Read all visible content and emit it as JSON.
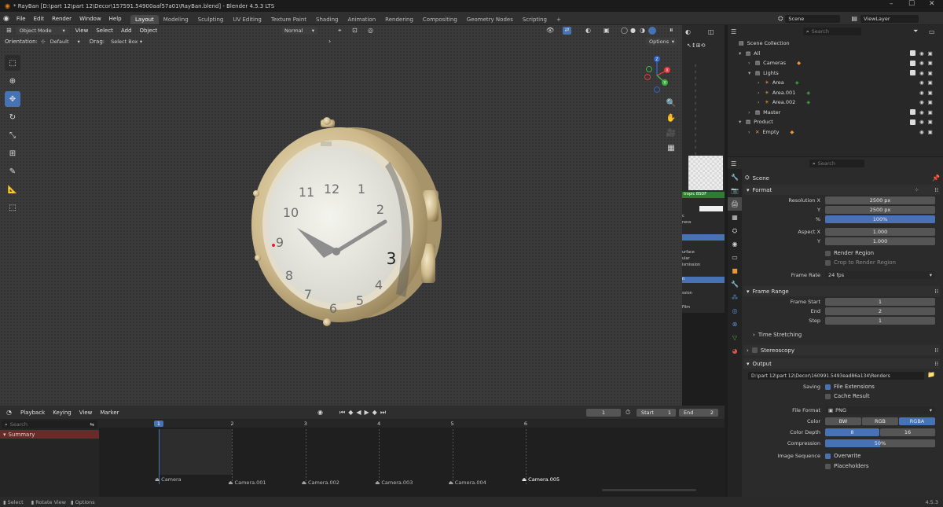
{
  "window": {
    "title": "* RayBan [D:\\part 12\\part 12\\Decor\\157591.54900aaf57a01\\RayBan.blend] - Blender 4.5.3 LTS"
  },
  "menu": [
    "File",
    "Edit",
    "Render",
    "Window",
    "Help"
  ],
  "workspaces": [
    {
      "label": "Layout",
      "active": true
    },
    {
      "label": "Modeling"
    },
    {
      "label": "Sculpting"
    },
    {
      "label": "UV Editing"
    },
    {
      "label": "Texture Paint"
    },
    {
      "label": "Shading"
    },
    {
      "label": "Animation"
    },
    {
      "label": "Rendering"
    },
    {
      "label": "Compositing"
    },
    {
      "label": "Geometry Nodes"
    },
    {
      "label": "Scripting"
    }
  ],
  "scene_name": "Scene",
  "view_layer": "ViewLayer",
  "viewport": {
    "mode": "Object Mode",
    "menus": [
      "View",
      "Select",
      "Add",
      "Object"
    ],
    "transform_orientation": "Normal",
    "orientation_label": "Orientation:",
    "orientation_value": "Default",
    "drag_label": "Drag:",
    "drag_value": "Select Box",
    "options_label": "Options",
    "gizmo_labels": {
      "z": "Z",
      "y": "Y",
      "x": "X"
    }
  },
  "midpanel_items": [
    "tropic BSDF",
    "c",
    "ness",
    "urface",
    "ular",
    "ismission",
    "n",
    "ssion",
    "Film"
  ],
  "outliner": {
    "search_placeholder": "Search",
    "root": "Scene Collection",
    "rows": [
      {
        "label": "All",
        "indent": 0,
        "expander": "▾",
        "kind": "collection",
        "checkbox": true,
        "eye": true,
        "camera": true
      },
      {
        "label": "Cameras",
        "indent": 1,
        "expander": "›",
        "kind": "collection",
        "checkbox": true,
        "eye": true,
        "camera": true
      },
      {
        "label": "Lights",
        "indent": 1,
        "expander": "▾",
        "kind": "collection",
        "checkbox": true,
        "eye": true,
        "camera": true
      },
      {
        "label": "Area",
        "indent": 2,
        "expander": "›",
        "kind": "light",
        "eye": true,
        "camera": true
      },
      {
        "label": "Area.001",
        "indent": 2,
        "expander": "›",
        "kind": "light",
        "eye": true,
        "camera": true
      },
      {
        "label": "Area.002",
        "indent": 2,
        "expander": "›",
        "kind": "light",
        "eye": true,
        "camera": true
      },
      {
        "label": "Master",
        "indent": 1,
        "expander": "›",
        "kind": "collection",
        "checkbox": true,
        "eye": true,
        "camera": true
      },
      {
        "label": "Product",
        "indent": 0,
        "expander": "▾",
        "kind": "collection",
        "checkbox": true,
        "eye": true,
        "camera": true
      },
      {
        "label": "Empty",
        "indent": 1,
        "expander": "›",
        "kind": "empty",
        "eye": true,
        "camera": true
      }
    ]
  },
  "properties": {
    "search_placeholder": "Search",
    "context": "Scene",
    "format": {
      "header": "Format",
      "resolution_x_label": "Resolution X",
      "resolution_x": "2500 px",
      "y_label": "Y",
      "resolution_y": "2500 px",
      "percent_label": "%",
      "percent": "100%",
      "aspect_x_label": "Aspect X",
      "aspect_x": "1.000",
      "aspect_y_label": "Y",
      "aspect_y": "1.000",
      "render_region": "Render Region",
      "crop_region": "Crop to Render Region",
      "frame_rate_label": "Frame Rate",
      "frame_rate": "24 fps"
    },
    "frame_range": {
      "header": "Frame Range",
      "start_label": "Frame Start",
      "start": "1",
      "end_label": "End",
      "end": "2",
      "step_label": "Step",
      "step": "1",
      "time_stretching": "Time Stretching"
    },
    "stereoscopy": "Stereoscopy",
    "output": {
      "header": "Output",
      "path": "D:\\part 12\\part 12\\Decor\\160991.5493ead86a134\\Renders",
      "saving_label": "Saving",
      "file_extensions": "File Extensions",
      "cache_result": "Cache Result",
      "file_format_label": "File Format",
      "file_format": "PNG",
      "color_label": "Color",
      "color_options": [
        "BW",
        "RGB",
        "RGBA"
      ],
      "color_selected": "RGBA",
      "color_depth_label": "Color Depth",
      "color_depth_options": [
        "8",
        "16"
      ],
      "color_depth_selected": "8",
      "compression_label": "Compression",
      "compression": "50%",
      "compression_value": 50,
      "image_sequence_label": "Image Sequence",
      "overwrite": "Overwrite",
      "placeholders": "Placeholders"
    }
  },
  "timeline": {
    "menus": [
      "Playback",
      "Keying",
      "View",
      "Marker"
    ],
    "current_frame": "1",
    "start_label": "Start",
    "start": "1",
    "end_label": "End",
    "end": "2",
    "search_placeholder": "Search",
    "summary": "Summary",
    "frame_ticks": [
      "1",
      "2",
      "3",
      "4",
      "5",
      "6"
    ],
    "cameras": [
      "Camera",
      "Camera.001",
      "Camera.002",
      "Camera.003",
      "Camera.004",
      "Camera.005"
    ]
  },
  "statusbar": {
    "items": [
      "Select",
      "Rotate View",
      "Options"
    ],
    "version": "4.5.3"
  },
  "clock_numbers": [
    "12",
    "11",
    "10",
    "9",
    "8",
    "7",
    "6",
    "5",
    "4",
    "3",
    "2",
    "1"
  ],
  "colors": {
    "accent": "#4772b3",
    "summary": "#8b2e2e"
  }
}
